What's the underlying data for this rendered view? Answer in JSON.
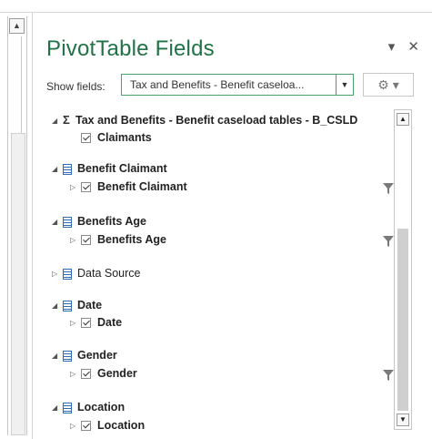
{
  "header": {
    "title": "PivotTable Fields",
    "dropdown_glyph": "▾",
    "close_glyph": "✕"
  },
  "show_fields": {
    "label": "Show fields:",
    "value": "Tax and Benefits - Benefit caseloa...",
    "gear_glyph": "⚙ ▾"
  },
  "fields": [
    {
      "expander": "◢",
      "icon": "sigma-icon",
      "label": "Tax and Benefits - Benefit caseload tables - B_CSLD",
      "bold": true,
      "child": {
        "expander": "",
        "label": "Claimants",
        "checked": true,
        "filtered": false
      }
    },
    {
      "expander": "◢",
      "icon": "table-icon",
      "label": "Benefit Claimant",
      "bold": true,
      "child": {
        "expander": "▷",
        "label": "Benefit Claimant",
        "checked": true,
        "filtered": true
      }
    },
    {
      "expander": "◢",
      "icon": "table-icon",
      "label": "Benefits Age",
      "bold": true,
      "child": {
        "expander": "▷",
        "label": "Benefits Age",
        "checked": true,
        "filtered": true
      }
    },
    {
      "expander": "▷",
      "icon": "table-icon",
      "label": "Data Source",
      "bold": false,
      "child": null
    },
    {
      "expander": "◢",
      "icon": "table-icon",
      "label": "Date",
      "bold": true,
      "child": {
        "expander": "▷",
        "label": "Date",
        "checked": true,
        "filtered": false
      }
    },
    {
      "expander": "◢",
      "icon": "table-icon",
      "label": "Gender",
      "bold": true,
      "child": {
        "expander": "▷",
        "label": "Gender",
        "checked": true,
        "filtered": true
      }
    },
    {
      "expander": "◢",
      "icon": "table-icon",
      "label": "Location",
      "bold": true,
      "child": {
        "expander": "▷",
        "label": "Location",
        "checked": true,
        "filtered": false
      }
    }
  ],
  "colors": {
    "title": "#217346",
    "accent_border": "#46a369",
    "table_icon": "#2f6cb5",
    "filter_icon": "#7a7a7a"
  }
}
